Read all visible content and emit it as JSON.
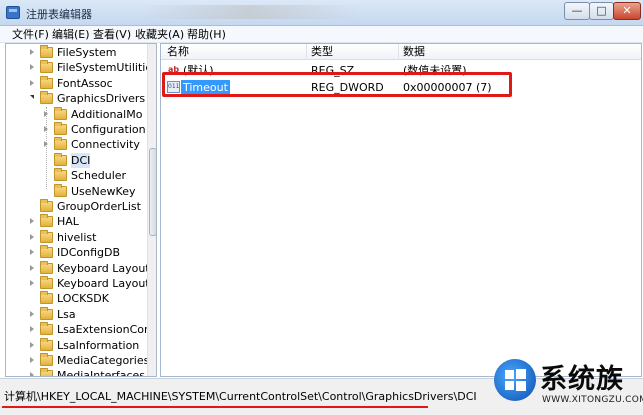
{
  "window": {
    "title": "注册表编辑器",
    "min_label": "—",
    "max_label": "□",
    "close_label": "✕"
  },
  "menu": [
    "文件(F)",
    "编辑(E)",
    "查看(V)",
    "收藏夹(A)",
    "帮助(H)"
  ],
  "tree": {
    "items": [
      {
        "label": "FileSystem",
        "expander": "closed"
      },
      {
        "label": "FileSystemUtilities",
        "expander": "closed"
      },
      {
        "label": "FontAssoc",
        "expander": "closed"
      },
      {
        "label": "GraphicsDrivers",
        "expander": "open"
      },
      {
        "label": "AdditionalMo",
        "expander": "closed"
      },
      {
        "label": "Configuration",
        "expander": "closed"
      },
      {
        "label": "Connectivity",
        "expander": "closed"
      },
      {
        "label": "DCI",
        "expander": "none",
        "selected": true
      },
      {
        "label": "Scheduler",
        "expander": "none"
      },
      {
        "label": "UseNewKey",
        "expander": "none"
      },
      {
        "label": "GroupOrderList",
        "expander": "none"
      },
      {
        "label": "HAL",
        "expander": "closed"
      },
      {
        "label": "hivelist",
        "expander": "closed"
      },
      {
        "label": "IDConfigDB",
        "expander": "closed"
      },
      {
        "label": "Keyboard Layout",
        "expander": "closed"
      },
      {
        "label": "Keyboard Layout",
        "expander": "closed"
      },
      {
        "label": "LOCKSDK",
        "expander": "none"
      },
      {
        "label": "Lsa",
        "expander": "closed"
      },
      {
        "label": "LsaExtensionConf",
        "expander": "closed"
      },
      {
        "label": "LsaInformation",
        "expander": "closed"
      },
      {
        "label": "MediaCategories",
        "expander": "closed"
      },
      {
        "label": "MediaInterfaces",
        "expander": "closed"
      }
    ]
  },
  "list": {
    "columns": [
      "名称",
      "类型",
      "数据"
    ],
    "rows": [
      {
        "icon": "string-value-icon",
        "name": "(默认)",
        "type": "REG_SZ",
        "data": "(数值未设置)"
      },
      {
        "icon": "dword-value-icon",
        "name": "Timeout",
        "type": "REG_DWORD",
        "data": "0x00000007 (7)",
        "selected": true
      }
    ]
  },
  "status": {
    "path": "计算机\\HKEY_LOCAL_MACHINE\\SYSTEM\\CurrentControlSet\\Control\\GraphicsDrivers\\DCI"
  },
  "watermark": {
    "brand": "系统族",
    "url": "WWW.XITONGZU.COM"
  },
  "colors": {
    "annotation_red": "#e01818",
    "selection_blue": "#3399ff"
  }
}
